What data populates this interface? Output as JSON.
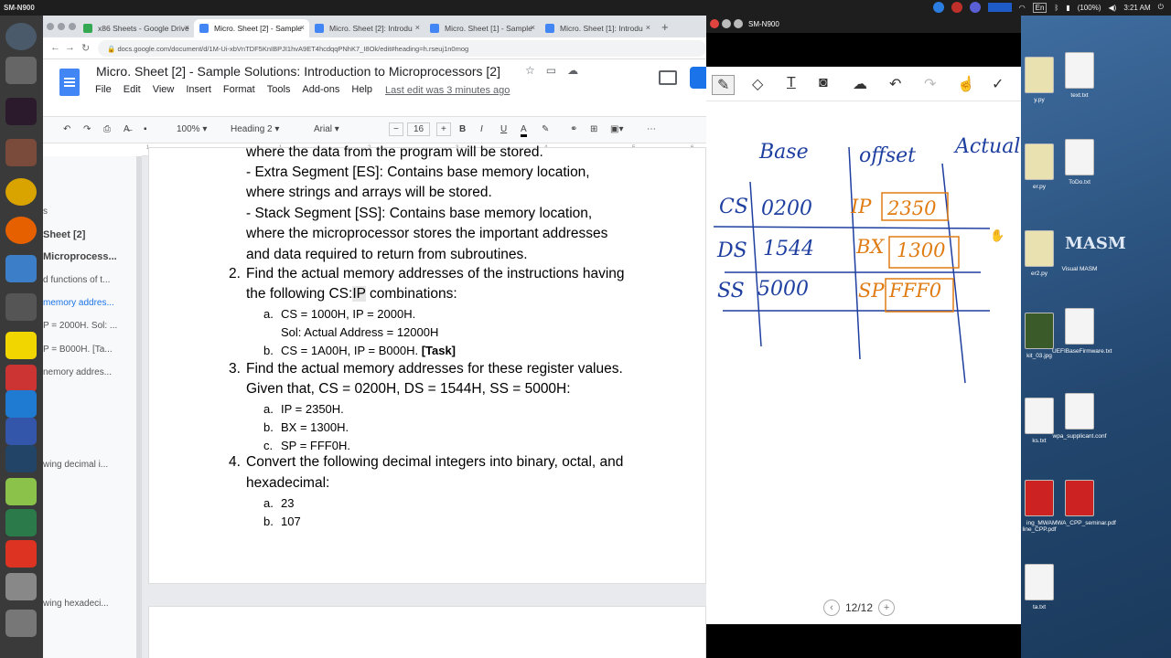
{
  "system": {
    "hostname": "SM-N900",
    "battery": "(100%)",
    "clock": "3:21 AM",
    "lang": "En"
  },
  "browser": {
    "tabs": [
      {
        "label": "x86 Sheets - Google Drive"
      },
      {
        "label": "Micro. Sheet [2] - Sample"
      },
      {
        "label": "Micro. Sheet [2]: Introdu"
      },
      {
        "label": "Micro. Sheet [1] - Sample"
      },
      {
        "label": "Micro. Sheet [1]: Introdu"
      }
    ],
    "new_tab": "+",
    "url": "docs.google.com/document/d/1M-Ui-xbVnTDF5KnIBPJI1hvA9ET4hcdqqPNhK7_I8Ok/edit#heading=h.rseuj1n0mog"
  },
  "doc": {
    "title": "Micro. Sheet [2] - Sample Solutions: Introduction to Microprocessors [2]",
    "menus": [
      "File",
      "Edit",
      "View",
      "Insert",
      "Format",
      "Tools",
      "Add-ons",
      "Help"
    ],
    "last_edit": "Last edit was 3 minutes ago",
    "toolbar": {
      "zoom": "100%",
      "style": "Heading 2",
      "font": "Arial",
      "size": "16",
      "minus": "−",
      "plus": "+",
      "bold": "B",
      "italic": "I",
      "underline": "U",
      "color": "A"
    },
    "ruler": [
      "1",
      "1",
      "2",
      "3",
      "4",
      "5",
      "6",
      "7"
    ],
    "outline": [
      {
        "text": "s"
      },
      {
        "text": "Sheet [2]"
      },
      {
        "text": "Microprocess..."
      },
      {
        "text": "d functions of t..."
      },
      {
        "text": "memory addres..."
      },
      {
        "text": "P = 2000H. Sol: ..."
      },
      {
        "text": "P = B000H. [Ta..."
      },
      {
        "text": "nemory addres..."
      },
      {
        "text": "wing decimal i..."
      },
      {
        "text": "wing hexadeci..."
      }
    ],
    "body": {
      "l1": "where the data from the program will be stored.",
      "l2": "- Extra Segment [ES]: Contains base memory location,",
      "l3": "where strings and arrays will be stored.",
      "l4": "- Stack Segment [SS]: Contains base memory location,",
      "l5": "where the microprocessor stores the important addresses",
      "l6": "and data required to return from subroutines.",
      "q2n": "2.",
      "q2a": "Find the actual memory addresses of the instructions having",
      "q2b": "the following CS:",
      "q2ip": "IP",
      "q2c": " combinations:",
      "q2_a_lbl": "a.",
      "q2_a": "CS = 1000H, IP = 2000H.",
      "q2_sol": "Sol: Actual Address = 12000H",
      "q2_b_lbl": "b.",
      "q2_b": "CS = 1A00H, IP = B000H. ",
      "q2_task": "[Task]",
      "q3n": "3.",
      "q3a": "Find the actual memory addresses for these register values.",
      "q3b": "Given that, CS = 0200H, DS = 1544H, SS = 5000H:",
      "q3_a_lbl": "a.",
      "q3_a": "IP = 2350H.",
      "q3_b_lbl": "b.",
      "q3_b": "BX = 1300H.",
      "q3_c_lbl": "c.",
      "q3_c": "SP = FFF0H.",
      "q4n": "4.",
      "q4a": "Convert the following decimal integers into binary, octal, and",
      "q4b": "hexadecimal:",
      "q4_a_lbl": "a.",
      "q4_a": "23",
      "q4_b_lbl": "b.",
      "q4_b": "107"
    }
  },
  "samsung": {
    "title": "SM-N900",
    "page_indicator": "12/12",
    "sketch": {
      "headers": [
        "Base",
        "offset",
        "Actual"
      ],
      "rows": [
        {
          "seg": "CS",
          "base": "0200",
          "reg": "IP",
          "off": "2350"
        },
        {
          "seg": "DS",
          "base": "1544",
          "reg": "BX",
          "off": "1300"
        },
        {
          "seg": "SS",
          "base": "5000",
          "reg": "SP",
          "off": "FFF0"
        }
      ]
    }
  },
  "desktop": {
    "icons": [
      {
        "label": "text.txt"
      },
      {
        "label": "ToDo.txt"
      },
      {
        "label": "Visual MASM"
      },
      {
        "label": "UEFIBaseFirmware.txt"
      },
      {
        "label": "wpa_supplicant.conf"
      },
      {
        "label": "MWA_CPP_seminar.pdf"
      },
      {
        "label": "y.py"
      },
      {
        "label": "er.py"
      },
      {
        "label": "er2.py"
      },
      {
        "label": "kit_03.jpg"
      },
      {
        "label": "ks.txt"
      },
      {
        "label": "ing_MWA\nline_CPP.pdf"
      },
      {
        "label": "ta.txt"
      }
    ],
    "masm_logo": "MASM"
  },
  "colors": {
    "accent": "#1a73e8",
    "sketch_orange": "#e07b12",
    "doc_blue": "#4285f4"
  }
}
